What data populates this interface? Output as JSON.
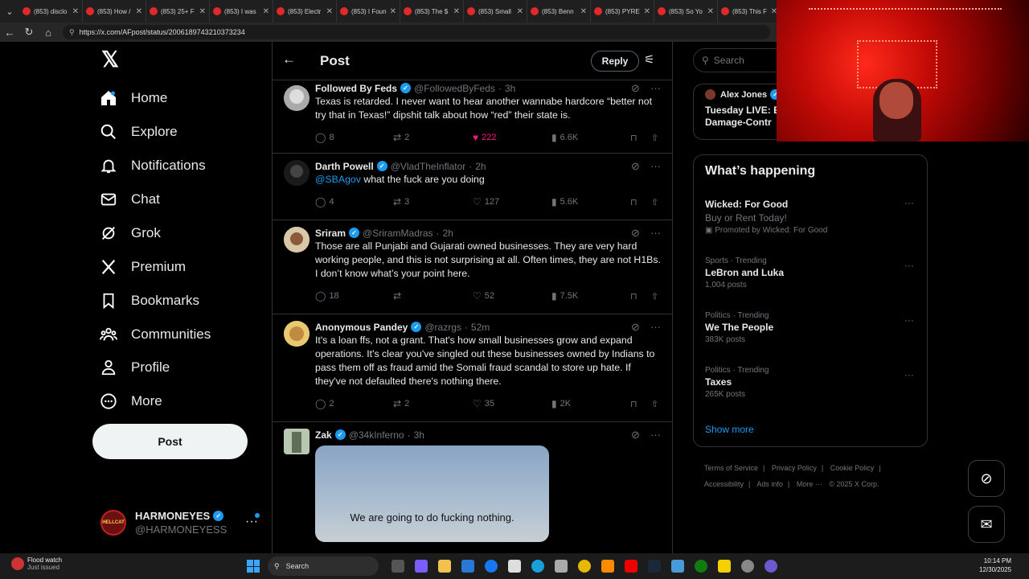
{
  "browser": {
    "tabs": [
      {
        "label": "(853) disclo"
      },
      {
        "label": "(853) How /"
      },
      {
        "label": "(853) 25+ F"
      },
      {
        "label": "(853) I was"
      },
      {
        "label": "(853) Electr"
      },
      {
        "label": "(853) I Foun"
      },
      {
        "label": "(853) The $"
      },
      {
        "label": "(853) Small"
      },
      {
        "label": "(853) Benn"
      },
      {
        "label": "(853) PYRE"
      },
      {
        "label": "(853) So Yo"
      },
      {
        "label": "(853) This F"
      }
    ],
    "url": "https://x.com/AFpost/status/2006189743210373234"
  },
  "nav": {
    "items": [
      {
        "label": "Home",
        "icon": "home-icon"
      },
      {
        "label": "Explore",
        "icon": "search-icon"
      },
      {
        "label": "Notifications",
        "icon": "bell-icon"
      },
      {
        "label": "Chat",
        "icon": "mail-icon"
      },
      {
        "label": "Grok",
        "icon": "grok-icon"
      },
      {
        "label": "Premium",
        "icon": "x-icon"
      },
      {
        "label": "Bookmarks",
        "icon": "bookmark-icon"
      },
      {
        "label": "Communities",
        "icon": "communities-icon"
      },
      {
        "label": "Profile",
        "icon": "person-icon"
      },
      {
        "label": "More",
        "icon": "more-circle-icon"
      }
    ],
    "post_label": "Post",
    "account": {
      "name": "HARMONEYES",
      "handle": "@HARMONEYESS",
      "avatar_text": "HELLCAT"
    }
  },
  "main": {
    "title": "Post",
    "reply_label": "Reply",
    "tweets": [
      {
        "name": "Followed By Feds",
        "handle": "@FollowedByFeds",
        "time": "3h",
        "text": "Texas is retarded. I never want to hear another wannabe hardcore “better not try that in Texas!” dipshit talk about how “red” their state is.",
        "replies": "8",
        "reposts": "2",
        "likes": "222",
        "views": "6.6K"
      },
      {
        "name": "Darth Powell",
        "handle": "@VladTheInflator",
        "time": "2h",
        "mention": "@SBAgov",
        "text": " what the fuck are you doing",
        "replies": "4",
        "reposts": "3",
        "likes": "127",
        "views": "5.6K"
      },
      {
        "name": "Sriram",
        "handle": "@SriramMadras",
        "time": "2h",
        "text": "Those are all Punjabi and Gujarati owned businesses. They are very hard working people, and this is not surprising at all. Often times, they are not H1Bs. I don’t know what’s your point here.",
        "replies": "18",
        "reposts": "",
        "likes": "52",
        "views": "7.5K"
      },
      {
        "name": "Anonymous Pandey",
        "handle": "@razrgs",
        "time": "52m",
        "text": "It's a loan ffs, not a grant. That's how small businesses grow and expand operations. It's  clear you've singled out these businesses owned by Indians to pass them off as fraud amid the Somali fraud scandal to store up hate. If they've not defaulted there's nothing there.",
        "replies": "2",
        "reposts": "2",
        "likes": "35",
        "views": "2K"
      },
      {
        "name": "Zak",
        "handle": "@34kInferno",
        "time": "3h",
        "media_caption": "We are going to do fucking nothing."
      }
    ]
  },
  "right": {
    "search_placeholder": "Search",
    "live": {
      "name": "Alex Jones",
      "line1": "Tuesday LIVE: E",
      "line2": "Damage-Contr"
    },
    "trends_title": "What’s happening",
    "trends": [
      {
        "context": "",
        "name": "Wicked: For Good",
        "sub": "Buy or Rent Today!",
        "count": "Promoted by Wicked: For Good"
      },
      {
        "context": "Sports · Trending",
        "name": "LeBron and Luka",
        "sub": "",
        "count": "1,004 posts"
      },
      {
        "context": "Politics · Trending",
        "name": "We The People",
        "sub": "",
        "count": "383K posts"
      },
      {
        "context": "Politics · Trending",
        "name": "Taxes",
        "sub": "",
        "count": "265K posts"
      }
    ],
    "show_more": "Show more",
    "footer": [
      "Terms of Service",
      "|",
      "Privacy Policy",
      "|",
      "Cookie Policy",
      "|",
      "Accessibility",
      "|",
      "Ads info",
      "|",
      "More ···",
      "© 2025 X Corp."
    ]
  },
  "taskbar": {
    "weather_title": "Flood watch",
    "weather_sub": "Just issued",
    "search_label": "Search",
    "time": "10:14 PM",
    "date": "12/30/2025"
  },
  "colors": {
    "accent": "#1d9bf0",
    "like": "#f91880",
    "background": "#000000"
  }
}
